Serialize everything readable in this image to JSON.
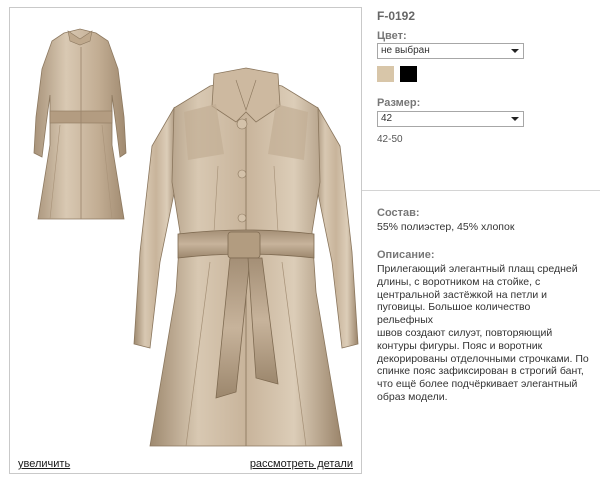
{
  "product": {
    "sku": "F-0192"
  },
  "color": {
    "label": "Цвет:",
    "select_value": "не выбран",
    "swatches": [
      {
        "name": "beige",
        "hex": "#d8c6a9"
      },
      {
        "name": "black",
        "hex": "#000000"
      }
    ]
  },
  "size": {
    "label": "Размер:",
    "select_value": "42",
    "range_text": "42-50"
  },
  "composition": {
    "label": "Состав:",
    "text": "55% полиэстер, 45% хлопок"
  },
  "description": {
    "label": "Описание:",
    "lines": [
      "Прилегающий элегантный плащ средней",
      "длины, с воротником на стойке, с",
      "центральной застёжкой на петли и",
      "пуговицы. Большое количество рельефных",
      "швов создают силуэт, повторяющий",
      "контуры фигуры. Пояс и воротник",
      "декорированы отделочными строчками. По",
      "спинке пояс зафиксирован в строгий бант,",
      "что ещё более подчёркивает элегантный",
      "образ модели."
    ]
  },
  "gallery": {
    "zoom_link": "увеличить",
    "details_link": "рассмотреть детали"
  },
  "colors": {
    "coat_fabric": "#c7b39b",
    "coat_shadow": "#9c876d",
    "coat_highlight": "#e7d9c6"
  }
}
